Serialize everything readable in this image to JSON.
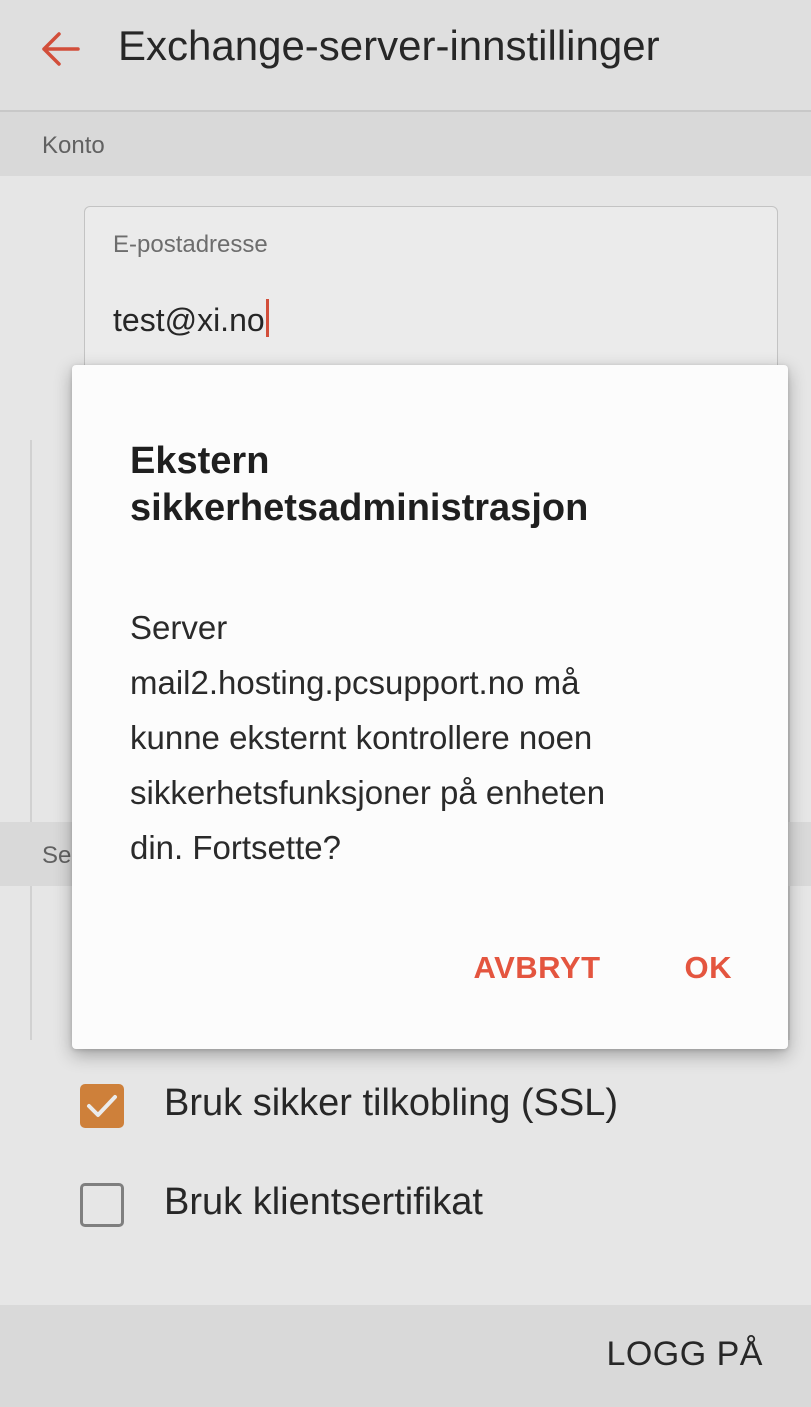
{
  "appbar": {
    "title": "Exchange-server-innstillinger",
    "back_icon": "arrow-left-icon"
  },
  "sections": {
    "account": "Konto",
    "server_partial": "Se"
  },
  "email": {
    "label": "E-postadresse",
    "value": "test@xi.no"
  },
  "options": [
    {
      "label": "Bruk sikker tilkobling (SSL)",
      "checked": true
    },
    {
      "label": "Bruk klientsertifikat",
      "checked": false
    }
  ],
  "footer": {
    "login_label": "LOGG PÅ"
  },
  "dialog": {
    "title_line1": "Ekstern",
    "title_line2": "sikkerhetsadministrasjon",
    "message_lines": [
      "Server",
      "mail2.hosting.pcsupport.no må",
      "kunne eksternt kontrollere noen",
      "sikkerhetsfunksjoner på enheten",
      "din. Fortsette?"
    ],
    "cancel_label": "AVBRYT",
    "ok_label": "OK"
  },
  "colors": {
    "accent": "#e4553f",
    "checkbox_checked": "#e08b3f",
    "text_primary": "#2b2b2b"
  }
}
